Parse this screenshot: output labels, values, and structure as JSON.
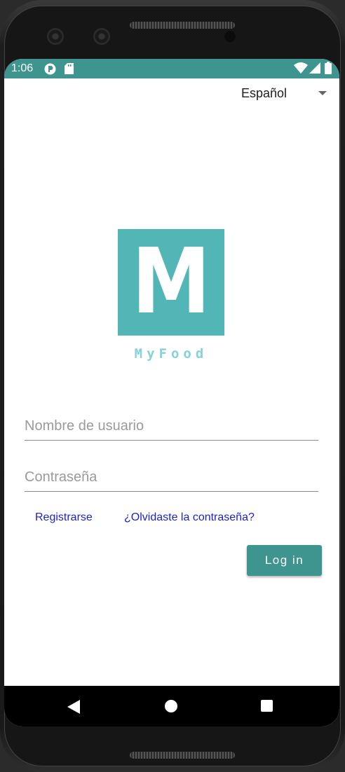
{
  "status_bar": {
    "time": "1:06",
    "color": "#3e948f",
    "icons": [
      "app-notification-icon",
      "sd-card-icon",
      "wifi-icon",
      "cell-signal-icon",
      "battery-icon"
    ]
  },
  "language": {
    "selected": "Español"
  },
  "logo": {
    "letter": "M",
    "caption": "MyFood",
    "box_color": "#52b5b6",
    "caption_color": "#86d2da"
  },
  "form": {
    "username_placeholder": "Nombre de usuario",
    "username_value": "",
    "password_placeholder": "Contraseña",
    "password_value": ""
  },
  "links": {
    "register": "Registrarse",
    "forgot_password": "¿Olvidaste la contraseña?"
  },
  "login_button": {
    "label": "Log in",
    "color": "#3e948f"
  },
  "nav_bar": {
    "icons": [
      "back-icon",
      "home-icon",
      "recents-icon"
    ]
  }
}
